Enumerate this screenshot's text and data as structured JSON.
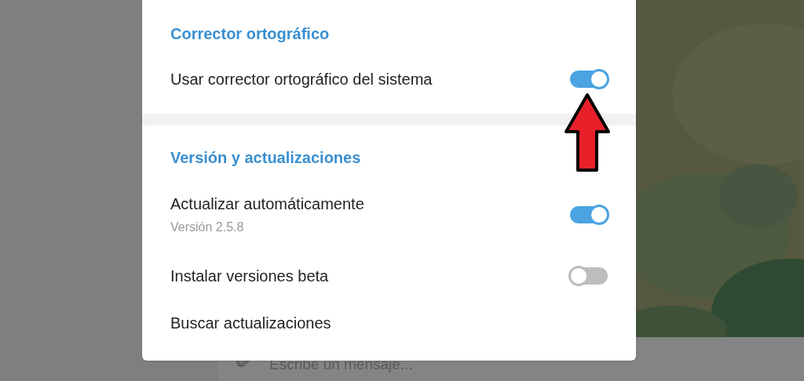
{
  "sections": [
    {
      "title": "Corrector ortográfico",
      "rows": [
        {
          "kind": "toggle",
          "label": "Usar corrector ortográfico del sistema",
          "on": true
        }
      ]
    },
    {
      "title": "Versión y actualizaciones",
      "rows": [
        {
          "kind": "toggle",
          "label": "Actualizar automáticamente",
          "sublabel": "Versión 2.5.8",
          "on": true
        },
        {
          "kind": "toggle",
          "label": "Instalar versiones beta",
          "on": false
        },
        {
          "kind": "link",
          "label": "Buscar actualizaciones"
        }
      ]
    }
  ],
  "composer": {
    "placeholder": "Escribe un mensaje..."
  }
}
